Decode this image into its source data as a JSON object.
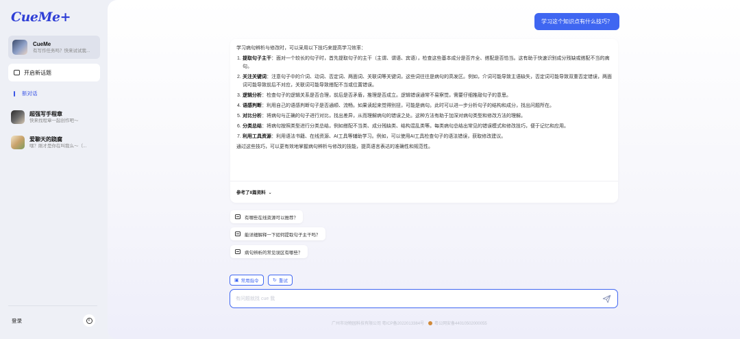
{
  "app": {
    "logo": "CueMe+"
  },
  "sidebar": {
    "agent": {
      "name": "CueMe",
      "subtitle": "有写作任务吗？快来试试我..."
    },
    "new_topic_label": "开启新话题",
    "current_conversation": "新对话",
    "chats": [
      {
        "name": "超强写手程章",
        "subtitle": "快来找程章一起创作吧～"
      },
      {
        "name": "爱聊天的跷腐",
        "subtitle": "嘿？刚才是你在叫我么～（..."
      }
    ],
    "login_label": "登录",
    "info_icon": "info-icon"
  },
  "chat": {
    "user_question": "学习这个知识点有什么技巧？",
    "answer": {
      "intro": "学习病句辨析与修改时，可以采用以下技巧来提高学习效率：",
      "items": [
        {
          "num": "1.",
          "title": "提取句子主干",
          "text": "：面对一个较长的句子时，首先提取句子的主干（主谓、谓语、宾语），检查这些基本成分是否齐全、搭配是否恰当。这有助于快速识别成分残缺或搭配不当的病句。"
        },
        {
          "num": "2.",
          "title": "关注关键词",
          "text": "：注意句子中的介词、动词、否定词、两面词、关联词等关键词，这些词往往是病句的高发区。例如，介词可能导致主语缺失，否定词可能导致双重否定错误，两面词可能导致前后不对应，关联词可能导致搭配不当或位置错误。"
        },
        {
          "num": "3.",
          "title": "逻辑分析",
          "text": "：检查句子的逻辑关系是否合理，前后是否矛盾，推理是否成立。逻辑错误通常不易察觉，需要仔细推敲句子的意思。"
        },
        {
          "num": "4.",
          "title": "语感判断",
          "text": "：利用自己的语感判断句子是否通顺、流畅。如果读起来觉得别扭，可能是病句。此时可以进一步分析句子的结构和成分，找出问题所在。"
        },
        {
          "num": "5.",
          "title": "对比分析",
          "text": "：将病句与正确的句子进行对比，找出差异，从而理解病句的错误之处。这种方法有助于加深对病句类型和修改方法的理解。"
        },
        {
          "num": "6.",
          "title": "分类总结",
          "text": "：将病句按照类型进行分类总结，例如搭配不当类、成分残缺类、结构混乱类等。每类病句总结出常见的错误模式和修改技巧，便于记忆和应用。"
        },
        {
          "num": "7.",
          "title": "利用工具资源",
          "text": "：利用语法书籍、在线资源、AI工具等辅助学习。例如，可以使用AI工具检查句子的语法错误，获取修改建议。"
        }
      ],
      "conclusion": "通过这些技巧，可以更有效地掌握病句辨析与修改的技能，提高语言表达的准确性和规范性。",
      "refs_label": "参考了8篇资料"
    },
    "suggestions": [
      "有哪些在线资源可以推荐？",
      "能详细解释一下如何提取句子主干吗？",
      "病句辨析的常见误区有哪些？"
    ],
    "tools": {
      "commands_label": "常用指令",
      "retry_label": "重试"
    },
    "input": {
      "placeholder": "有问题就找 cue 我"
    }
  },
  "footer": {
    "company": "广州市动物园科技有限公司 粤ICP备2022013384号",
    "police": "粤公网安备44010502000055"
  },
  "colors": {
    "accent": "#3f66f1",
    "sidebar_bg": "#eef0f6"
  }
}
